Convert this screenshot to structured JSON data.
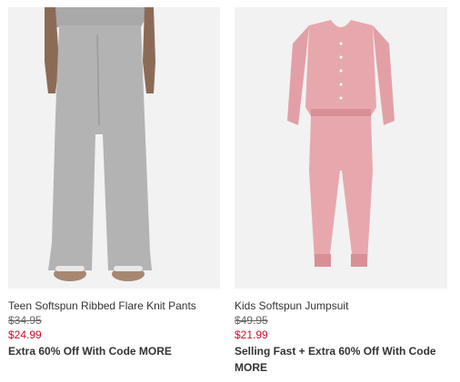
{
  "products": [
    {
      "name": "Teen Softspun Ribbed Flare Knit Pants",
      "original_price": "$34.95",
      "sale_price": "$24.99",
      "promo": "Extra 60% Off With Code MORE",
      "image_icon": "gray-flare-pants-photo"
    },
    {
      "name": "Kids Softspun Jumpsuit",
      "original_price": "$49.95",
      "sale_price": "$21.99",
      "promo": "Selling Fast + Extra 60% Off With Code MORE",
      "image_icon": "pink-jumpsuit-photo"
    }
  ],
  "colors": {
    "sale_price": "#c8102e",
    "image_bg": "#f2f2f2"
  }
}
